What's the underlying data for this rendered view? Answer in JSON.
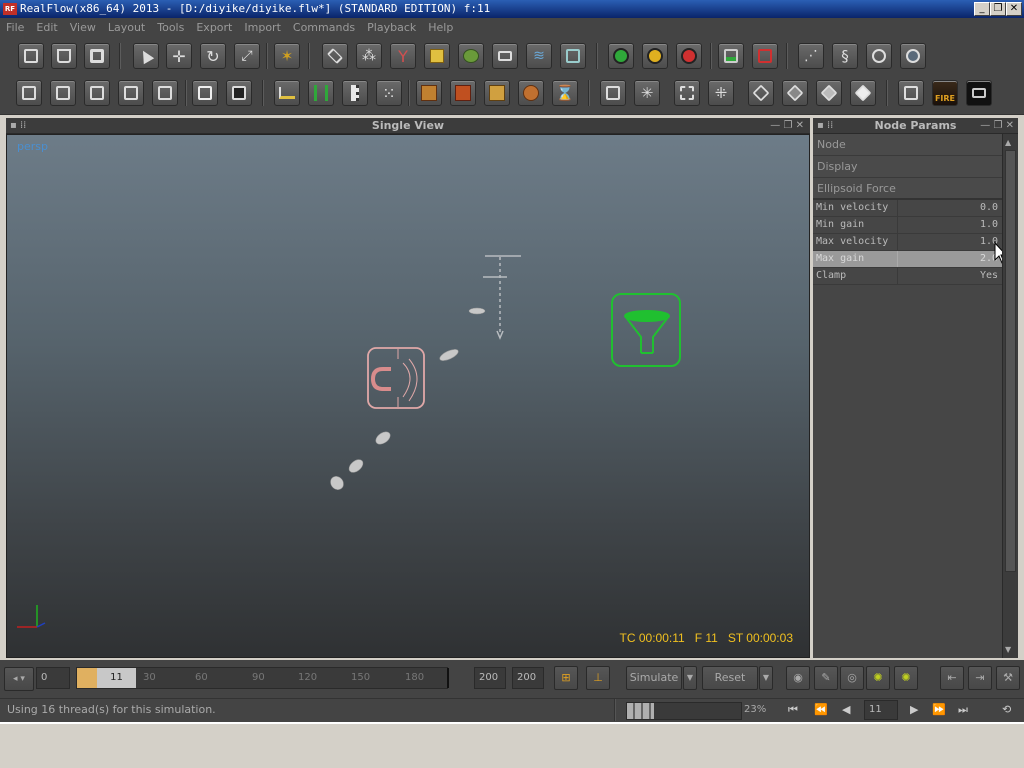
{
  "window": {
    "icon_text": "RF",
    "title": "RealFlow(x86_64) 2013 - [D:/diyike/diyike.flw*] (STANDARD EDITION) f:11",
    "min": "_",
    "max": "❐",
    "close": "✕"
  },
  "menu": [
    "File",
    "Edit",
    "View",
    "Layout",
    "Tools",
    "Export",
    "Import",
    "Commands",
    "Playback",
    "Help"
  ],
  "toolbar1": {
    "icons": [
      "new-file-icon",
      "open-file-icon",
      "save-icon",
      "select-icon",
      "move-icon",
      "rotate-icon",
      "scale-icon",
      "axis-icon",
      "particles-emitter-icon",
      "molecule-icon",
      "daemon-icon",
      "object-icon",
      "mesh-icon",
      "camera-icon",
      "wave-icon",
      "hybrido-icon"
    ],
    "sim_dots": [
      "#2fa83a",
      "#e0b020",
      "#d03030"
    ],
    "end_icons": [
      "save-sim-icon",
      "save-sim-red-icon",
      "batch-script-icon",
      "python-icon",
      "clock-icon",
      "globe-icon"
    ]
  },
  "toolbar2": {
    "icons": [
      "layer-icon",
      "layer-add-icon",
      "layer-scale-icon",
      "layer-link-icon",
      "layer-export-icon",
      "box-icon",
      "box-dark-icon",
      "graph-icon",
      "relationship-icon",
      "ruler-icon",
      "grid-icon",
      "texture-icon",
      "texture2-icon",
      "map-icon",
      "target-icon",
      "hourglass-icon",
      "cube-gear-icon",
      "cube-burst-icon",
      "frame-icon",
      "scatter-icon",
      "cube-wire-icon",
      "cube-shaded-icon",
      "cube-solid-icon",
      "cube-white-icon",
      "render-icon",
      "fire-icon",
      "camera-dark-icon"
    ],
    "fire_label": "FIRE"
  },
  "viewport": {
    "title": "Single View",
    "label": "persp",
    "tc": "TC 00:00:11",
    "frame": "F 11",
    "st": "ST 00:00:03"
  },
  "node_params": {
    "title": "Node Params",
    "sections": [
      "Node",
      "Display",
      "Ellipsoid Force"
    ],
    "rows": [
      {
        "key": "Min velocity",
        "value": "0.0"
      },
      {
        "key": "Min gain",
        "value": "1.0"
      },
      {
        "key": "Max velocity",
        "value": "1.0"
      },
      {
        "key": "Max gain",
        "value": "2.0"
      },
      {
        "key": "Clamp",
        "value": "Yes"
      }
    ],
    "selected_row": 3
  },
  "timeline": {
    "start": "0",
    "current": "11",
    "ticks": [
      "30",
      "60",
      "90",
      "120",
      "150",
      "180"
    ],
    "end1": "200",
    "end2": "200",
    "simulate": "Simulate",
    "reset": "Reset",
    "percent": "23%",
    "frame_field": "11"
  },
  "status": {
    "message": "Using 16 thread(s) for this simulation."
  }
}
